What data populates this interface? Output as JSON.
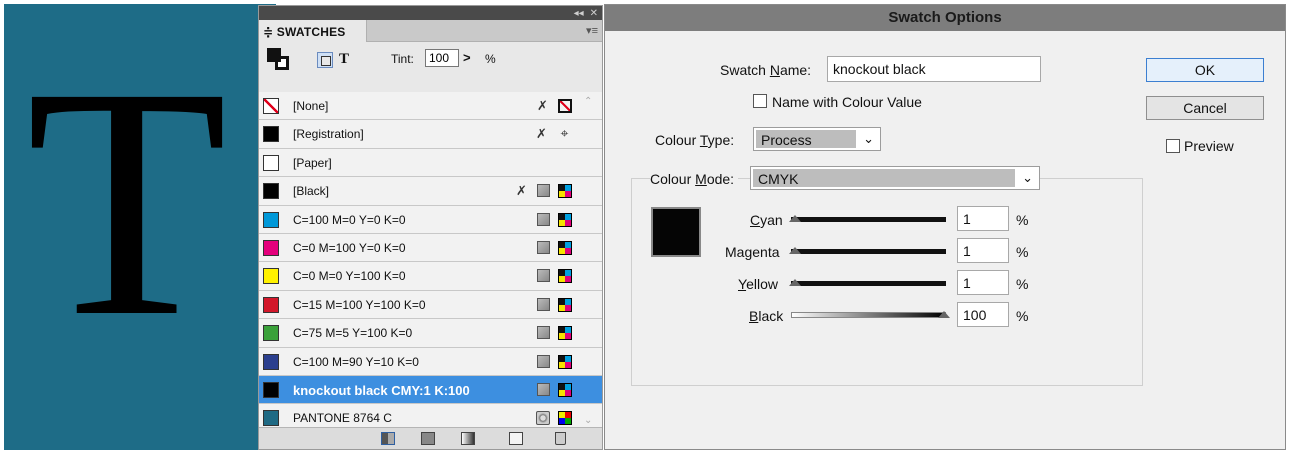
{
  "canvas": {
    "glyph": "T",
    "background": "#1e6c87"
  },
  "swatches_panel": {
    "collapse_glyph": "◂◂",
    "close_glyph": "✕",
    "tab_label": "≑ SWATCHES",
    "menu_glyph": "▾≡",
    "format_text_label": "T",
    "tint_label": "Tint:",
    "tint_value": "100",
    "tint_arrow": ">",
    "tint_unit": "%",
    "scroll_up_glyph": "⌃",
    "scroll_down_glyph": "⌄",
    "rows": [
      {
        "label": "[None]",
        "color": "none",
        "icons": [
          "pencil-off",
          "none"
        ]
      },
      {
        "label": "[Registration]",
        "color": "#000000",
        "icons": [
          "pencil-off",
          "registration"
        ]
      },
      {
        "label": "[Paper]",
        "color": "#ffffff",
        "icons": []
      },
      {
        "label": "[Black]",
        "color": "#000000",
        "icons": [
          "pencil-off",
          "process",
          "cmyk"
        ]
      },
      {
        "label": "C=100 M=0 Y=0 K=0",
        "color": "#0098d8",
        "icons": [
          "process",
          "cmyk"
        ]
      },
      {
        "label": "C=0 M=100 Y=0 K=0",
        "color": "#e4007c",
        "icons": [
          "process",
          "cmyk"
        ]
      },
      {
        "label": "C=0 M=0 Y=100 K=0",
        "color": "#fff200",
        "icons": [
          "process",
          "cmyk"
        ]
      },
      {
        "label": "C=15 M=100 Y=100 K=0",
        "color": "#d2172a",
        "icons": [
          "process",
          "cmyk"
        ]
      },
      {
        "label": "C=75 M=5 Y=100 K=0",
        "color": "#3aa13a",
        "icons": [
          "process",
          "cmyk"
        ]
      },
      {
        "label": "C=100 M=90 Y=10 K=0",
        "color": "#2b3f8e",
        "icons": [
          "process",
          "cmyk"
        ]
      },
      {
        "label": "knockout black CMY:1 K:100",
        "color": "#000000",
        "selected": true,
        "icons": [
          "process",
          "cmyk"
        ]
      },
      {
        "label": "PANTONE 8764 C",
        "color": "#1f6a84",
        "icons": [
          "spot",
          "spot-mixed"
        ]
      }
    ],
    "bottom_icons": [
      "show-all-swatches-icon",
      "show-color-swatches-icon",
      "show-gradient-swatches-icon",
      "new-swatch-icon",
      "delete-swatch-icon"
    ]
  },
  "dialog": {
    "title": "Swatch Options",
    "swatch_name_label_pre": "Swatch ",
    "swatch_name_label_u": "N",
    "swatch_name_label_post": "ame:",
    "swatch_name_value": "knockout black",
    "name_with_value_label": "Name with Colour Value",
    "colour_type_label_pre": "Colour ",
    "colour_type_label_u": "T",
    "colour_type_label_post": "ype:",
    "colour_type_value": "Process",
    "colour_mode_label_pre": "Colour ",
    "colour_mode_label_u": "M",
    "colour_mode_label_post": "ode:",
    "colour_mode_value": "CMYK",
    "dropdown_glyph": "⌄",
    "preview_color": "#050505",
    "percent_unit": "%",
    "channels": [
      {
        "label_u": "C",
        "label_rest": "yan",
        "value": "1",
        "level": 1
      },
      {
        "label_pre": "Ma",
        "label_u": "g",
        "label_rest": "enta",
        "value": "1",
        "level": 1
      },
      {
        "label_u": "Y",
        "label_rest": "ellow",
        "value": "1",
        "level": 1
      },
      {
        "label_u": "B",
        "label_rest": "lack",
        "value": "100",
        "level": 100
      }
    ],
    "ok_label": "OK",
    "cancel_label": "Cancel",
    "preview_label": "Preview"
  }
}
